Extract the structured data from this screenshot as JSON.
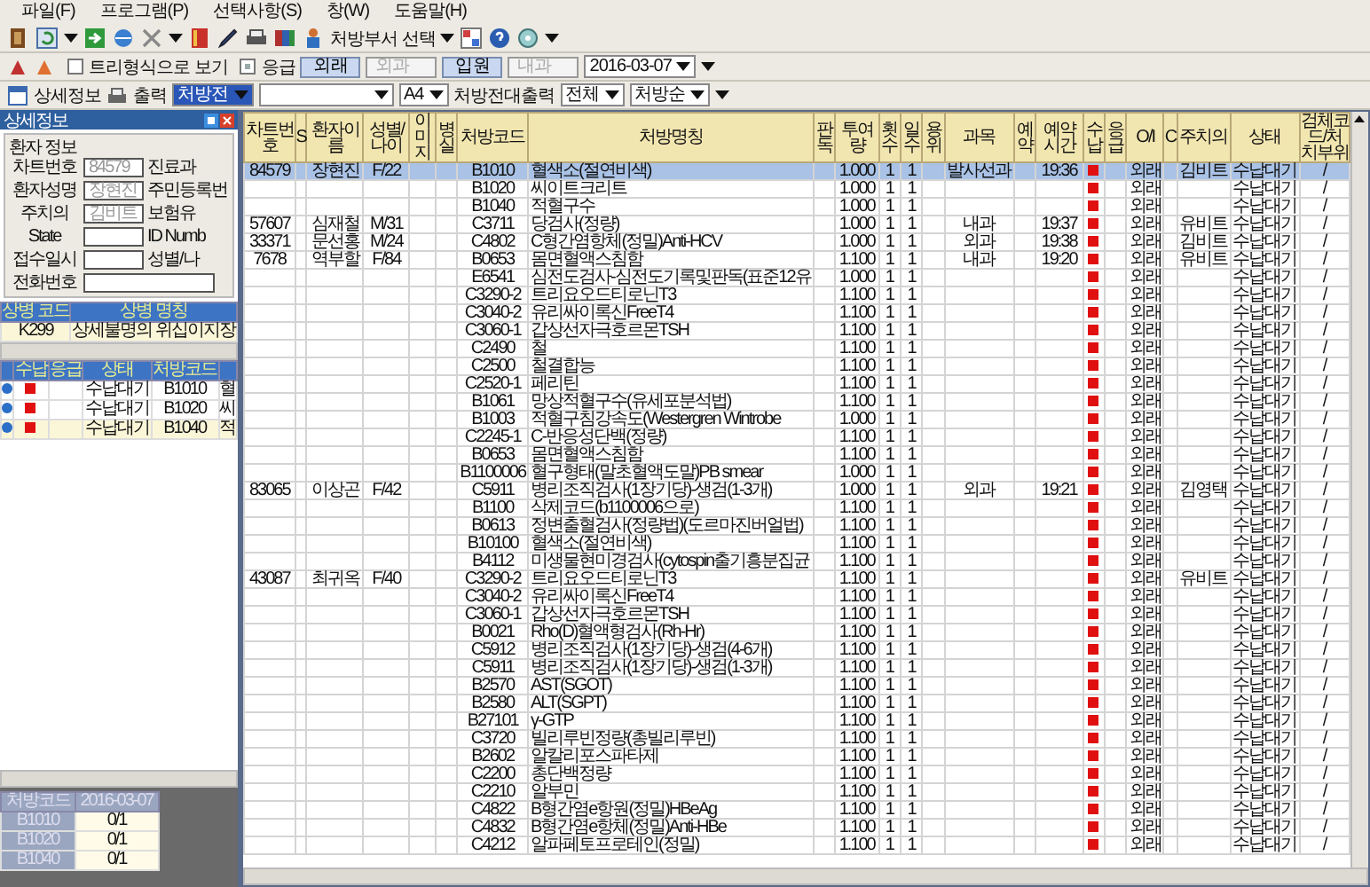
{
  "menu": [
    "파일(F)",
    "프로그램(P)",
    "선택사항(S)",
    "창(W)",
    "도움말(H)"
  ],
  "toolbar": {
    "dept_select": "처방부서 선택"
  },
  "filter_bar": {
    "tree_view": {
      "label": "트리형식으로 보기",
      "checked": false
    },
    "emergency": {
      "label": "응급",
      "checked": true
    },
    "pairs": [
      {
        "button": "외래",
        "value": "외과"
      },
      {
        "button": "입원",
        "value": "내과"
      }
    ],
    "date": "2016-03-07"
  },
  "print_bar": {
    "detail": "상세정보",
    "print": "출력",
    "form": "처방전",
    "paper": "A4",
    "label": "처방전대출력",
    "range": "전체",
    "order": "처방순"
  },
  "detail_panel": {
    "title": "상세정보",
    "group": "환자 정보",
    "fields": [
      {
        "label": "차트번호",
        "value": "84579",
        "side_label": "진료과"
      },
      {
        "label": "환자성명",
        "value": "장현진",
        "side_label": "주민등록번"
      },
      {
        "label": "주치의",
        "value": "김비트",
        "side_label": "보험유"
      },
      {
        "label": "State",
        "side_label": "ID Numb"
      },
      {
        "label": "접수일시",
        "side_label": "성별/나"
      },
      {
        "label": "전화번호"
      }
    ],
    "diseases": {
      "columns": [
        "상병 코드",
        "상병 명칭"
      ],
      "rows": [
        [
          "K299",
          "상세불명의 위십이지장"
        ]
      ]
    },
    "orders": {
      "columns": [
        "수납",
        "응급",
        "상태",
        "처방코드"
      ],
      "rows": [
        {
          "status": "수납대기",
          "code": "B1010",
          "name": "혈"
        },
        {
          "status": "수납대기",
          "code": "B1020",
          "name": "씨"
        },
        {
          "status": "수납대기",
          "code": "B1040",
          "name": "적"
        }
      ]
    },
    "counts": {
      "columns": [
        "처방코드",
        "2016-03-07"
      ],
      "rows": [
        [
          "B1010",
          "0/1"
        ],
        [
          "B1020",
          "0/1"
        ],
        [
          "B1040",
          "0/1"
        ]
      ]
    }
  },
  "orders_table": {
    "columns": [
      "차트번호",
      "S",
      "환자이름",
      "성별/나이",
      "이미지",
      "병실",
      "처방코드",
      "처방명칭",
      "판독",
      "투여량",
      "횟수",
      "일수",
      "용위",
      "과목",
      "예약",
      "예약시간",
      "수납",
      "응급",
      "O/I",
      "C",
      "주치의",
      "상태",
      "검체코드/처치부위"
    ],
    "rows": [
      {
        "selected": true,
        "chart_no": "84579",
        "patient": "장현진",
        "sex_age": "F/22",
        "code": "B1010",
        "order_name": "혈색소(절연비색)",
        "dose": "1.000",
        "times": "1",
        "days": "1",
        "dept": "발사선과",
        "reserve_time": "19:36",
        "visit": "외래",
        "doctor": "김비트",
        "status": "수납대기",
        "site": "/"
      },
      {
        "selected": false,
        "code": "B1020",
        "order_name": "씨이트크리트",
        "dose": "1.000",
        "times": "1",
        "days": "1",
        "visit": "외래",
        "status": "수납대기",
        "site": "/"
      },
      {
        "selected": false,
        "code": "B1040",
        "order_name": "적혈구수",
        "dose": "1.000",
        "times": "1",
        "days": "1",
        "visit": "외래",
        "status": "수납대기",
        "site": "/"
      },
      {
        "selected": false,
        "chart_no": "57607",
        "patient": "심재철",
        "sex_age": "M/31",
        "code": "C3711",
        "order_name": "당검사(정량)",
        "dose": "1.000",
        "times": "1",
        "days": "1",
        "dept": "내과",
        "reserve_time": "19:37",
        "visit": "외래",
        "doctor": "유비트",
        "status": "수납대기",
        "site": "/"
      },
      {
        "selected": false,
        "chart_no": "33371",
        "patient": "문선홍",
        "sex_age": "M/24",
        "code": "C4802",
        "order_name": "C형간염항체(정밀)Anti-HCV",
        "dose": "1.000",
        "times": "1",
        "days": "1",
        "dept": "외과",
        "reserve_time": "19:38",
        "visit": "외래",
        "doctor": "김비트",
        "status": "수납대기",
        "site": "/"
      },
      {
        "selected": false,
        "chart_no": "7678",
        "patient": "역부할",
        "sex_age": "F/84",
        "code": "B0653",
        "order_name": "몸면혈액스침함",
        "dose": "1.100",
        "times": "1",
        "days": "1",
        "dept": "내과",
        "reserve_time": "19:20",
        "visit": "외래",
        "doctor": "유비트",
        "status": "수납대기",
        "site": "/"
      },
      {
        "selected": false,
        "code": "E6541",
        "order_name": "심전도검사-심전도기록및판독(표준12유",
        "dose": "1.000",
        "times": "1",
        "days": "1",
        "visit": "외래",
        "status": "수납대기",
        "site": "/"
      },
      {
        "selected": false,
        "code": "C3290-2",
        "order_name": "트리요오드티로닌T3",
        "dose": "1.100",
        "times": "1",
        "days": "1",
        "visit": "외래",
        "status": "수납대기",
        "site": "/"
      },
      {
        "selected": false,
        "code": "C3040-2",
        "order_name": "유리싸이록신FreeT4",
        "dose": "1.100",
        "times": "1",
        "days": "1",
        "visit": "외래",
        "status": "수납대기",
        "site": "/"
      },
      {
        "selected": false,
        "code": "C3060-1",
        "order_name": "갑상선자극호르몬TSH",
        "dose": "1.100",
        "times": "1",
        "days": "1",
        "visit": "외래",
        "status": "수납대기",
        "site": "/"
      },
      {
        "selected": false,
        "code": "C2490",
        "order_name": "철",
        "dose": "1.100",
        "times": "1",
        "days": "1",
        "visit": "외래",
        "status": "수납대기",
        "site": "/"
      },
      {
        "selected": false,
        "code": "C2500",
        "order_name": "철결합능",
        "dose": "1.100",
        "times": "1",
        "days": "1",
        "visit": "외래",
        "status": "수납대기",
        "site": "/"
      },
      {
        "selected": false,
        "code": "C2520-1",
        "order_name": "페리틴",
        "dose": "1.100",
        "times": "1",
        "days": "1",
        "visit": "외래",
        "status": "수납대기",
        "site": "/"
      },
      {
        "selected": false,
        "code": "B1061",
        "order_name": "망상적혈구수(유세포분석법)",
        "dose": "1.100",
        "times": "1",
        "days": "1",
        "visit": "외래",
        "status": "수납대기",
        "site": "/"
      },
      {
        "selected": false,
        "code": "B1003",
        "order_name": "적혈구침강속도(Westergren Wintrobe",
        "dose": "1.000",
        "times": "1",
        "days": "1",
        "visit": "외래",
        "status": "수납대기",
        "site": "/"
      },
      {
        "selected": false,
        "code": "C2245-1",
        "order_name": "C-반응성단백(정량)",
        "dose": "1.100",
        "times": "1",
        "days": "1",
        "visit": "외래",
        "status": "수납대기",
        "site": "/"
      },
      {
        "selected": false,
        "code": "B0653",
        "order_name": "몸면혈액스침함",
        "dose": "1.100",
        "times": "1",
        "days": "1",
        "visit": "외래",
        "status": "수납대기",
        "site": "/"
      },
      {
        "selected": false,
        "code": "B1100006",
        "order_name": "혈구형태(말초혈액도말)PB smear",
        "dose": "1.000",
        "times": "1",
        "days": "1",
        "visit": "외래",
        "status": "수납대기",
        "site": "/"
      },
      {
        "selected": false,
        "chart_no": "83065",
        "patient": "이상곤",
        "sex_age": "F/42",
        "code": "C5911",
        "order_name": "병리조직검사(1장기당)-생검(1-3개)",
        "dose": "1.000",
        "times": "1",
        "days": "1",
        "dept": "외과",
        "reserve_time": "19:21",
        "visit": "외래",
        "doctor": "김영택",
        "status": "수납대기",
        "site": "/"
      },
      {
        "selected": false,
        "code": "B1100",
        "order_name": "삭제코드(b1100006으로)",
        "dose": "1.100",
        "times": "1",
        "days": "1",
        "visit": "외래",
        "status": "수납대기",
        "site": "/"
      },
      {
        "selected": false,
        "code": "B0613",
        "order_name": "정변출혈검사(정량법)(도르마진버얼법)",
        "dose": "1.100",
        "times": "1",
        "days": "1",
        "visit": "외래",
        "status": "수납대기",
        "site": "/"
      },
      {
        "selected": false,
        "code": "B10100",
        "order_name": "혈색소(절연비색)",
        "dose": "1.100",
        "times": "1",
        "days": "1",
        "visit": "외래",
        "status": "수납대기",
        "site": "/"
      },
      {
        "selected": false,
        "code": "B4112",
        "order_name": "미생물현미경검사(cytospin출기흥분집균",
        "dose": "1.100",
        "times": "1",
        "days": "1",
        "visit": "외래",
        "status": "수납대기",
        "site": "/"
      },
      {
        "selected": false,
        "chart_no": "43087",
        "patient": "최귀옥",
        "sex_age": "F/40",
        "code": "C3290-2",
        "order_name": "트리요오드티로닌T3",
        "dose": "1.100",
        "times": "1",
        "days": "1",
        "visit": "외래",
        "doctor": "유비트",
        "status": "수납대기",
        "site": "/"
      },
      {
        "selected": false,
        "code": "C3040-2",
        "order_name": "유리싸이록신FreeT4",
        "dose": "1.100",
        "times": "1",
        "days": "1",
        "visit": "외래",
        "status": "수납대기",
        "site": "/"
      },
      {
        "selected": false,
        "code": "C3060-1",
        "order_name": "갑상선자극호르몬TSH",
        "dose": "1.100",
        "times": "1",
        "days": "1",
        "visit": "외래",
        "status": "수납대기",
        "site": "/"
      },
      {
        "selected": false,
        "code": "B0021",
        "order_name": "Rho(D)혈액형검사(Rh-Hr)",
        "dose": "1.100",
        "times": "1",
        "days": "1",
        "visit": "외래",
        "status": "수납대기",
        "site": "/"
      },
      {
        "selected": false,
        "code": "C5912",
        "order_name": "병리조직검사(1장기당)-생검(4-6개)",
        "dose": "1.100",
        "times": "1",
        "days": "1",
        "visit": "외래",
        "status": "수납대기",
        "site": "/"
      },
      {
        "selected": false,
        "code": "C5911",
        "order_name": "병리조직검사(1장기당)-생검(1-3개)",
        "dose": "1.100",
        "times": "1",
        "days": "1",
        "visit": "외래",
        "status": "수납대기",
        "site": "/"
      },
      {
        "selected": false,
        "code": "B2570",
        "order_name": "AST(SGOT)",
        "dose": "1.100",
        "times": "1",
        "days": "1",
        "visit": "외래",
        "status": "수납대기",
        "site": "/"
      },
      {
        "selected": false,
        "code": "B2580",
        "order_name": "ALT(SGPT)",
        "dose": "1.100",
        "times": "1",
        "days": "1",
        "visit": "외래",
        "status": "수납대기",
        "site": "/"
      },
      {
        "selected": false,
        "code": "B27101",
        "order_name": "γ-GTP",
        "dose": "1.100",
        "times": "1",
        "days": "1",
        "visit": "외래",
        "status": "수납대기",
        "site": "/"
      },
      {
        "selected": false,
        "code": "C3720",
        "order_name": "빌리루빈정량(총빌리루빈)",
        "dose": "1.100",
        "times": "1",
        "days": "1",
        "visit": "외래",
        "status": "수납대기",
        "site": "/"
      },
      {
        "selected": false,
        "code": "B2602",
        "order_name": "알칼리포스파타제",
        "dose": "1.100",
        "times": "1",
        "days": "1",
        "visit": "외래",
        "status": "수납대기",
        "site": "/"
      },
      {
        "selected": false,
        "code": "C2200",
        "order_name": "총단백정량",
        "dose": "1.100",
        "times": "1",
        "days": "1",
        "visit": "외래",
        "status": "수납대기",
        "site": "/"
      },
      {
        "selected": false,
        "code": "C2210",
        "order_name": "알부민",
        "dose": "1.100",
        "times": "1",
        "days": "1",
        "visit": "외래",
        "status": "수납대기",
        "site": "/"
      },
      {
        "selected": false,
        "code": "C4822",
        "order_name": "B형간염e항원(정밀)HBeAg",
        "dose": "1.100",
        "times": "1",
        "days": "1",
        "visit": "외래",
        "status": "수납대기",
        "site": "/"
      },
      {
        "selected": false,
        "code": "C4832",
        "order_name": "B형간염e항체(정밀)Anti-HBe",
        "dose": "1.100",
        "times": "1",
        "days": "1",
        "visit": "외래",
        "status": "수납대기",
        "site": "/"
      },
      {
        "selected": false,
        "code": "C4212",
        "order_name": "알파페토프로테인(정밀)",
        "dose": "1.100",
        "times": "1",
        "days": "1",
        "visit": "외래",
        "status": "수납대기",
        "site": "/"
      }
    ]
  }
}
